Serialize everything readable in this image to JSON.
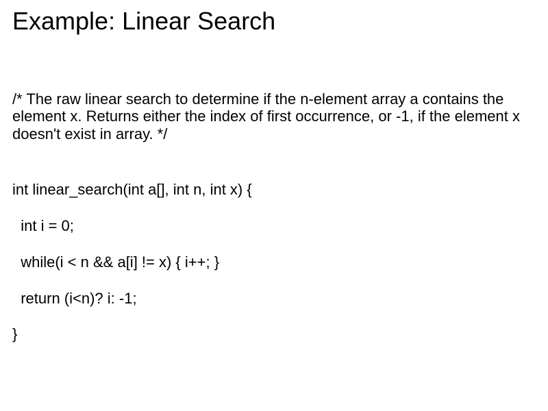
{
  "title": "Example: Linear Search",
  "comment": "/* The raw linear search to determine if the n-element array a contains the element x. Returns either the index of first occurrence, or -1, if the element x doesn't exist in array. */",
  "code": {
    "line1": "int linear_search(int a[], int n, int x) {",
    "line2": "  int i = 0;",
    "line3": "  while(i < n && a[i] != x) { i++; }",
    "line4": "  return (i<n)? i: -1;",
    "line5": "}"
  }
}
